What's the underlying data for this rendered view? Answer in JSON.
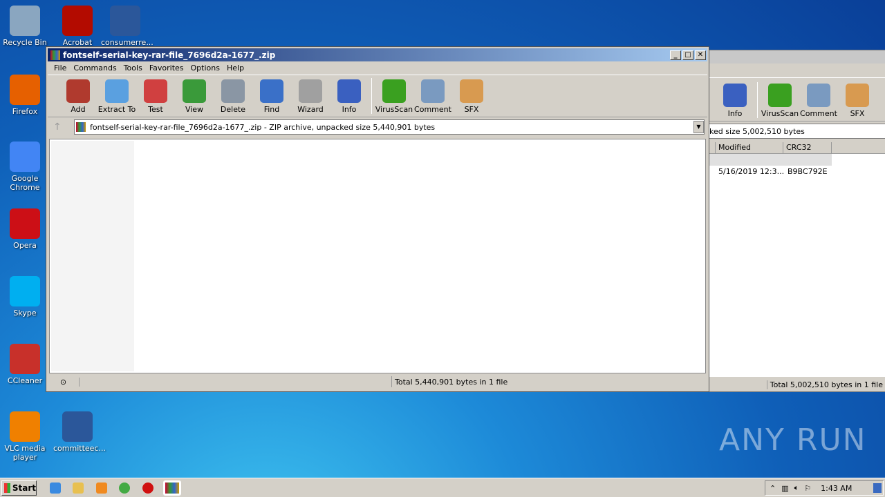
{
  "desktop": {
    "icons": [
      {
        "label": "Recycle Bin",
        "color": "#8aa6c0"
      },
      {
        "label": "Acrobat",
        "color": "#b30b00"
      },
      {
        "label": "consumerre...",
        "color": "#2b579a"
      },
      {
        "label": "Firefox",
        "color": "#e66000"
      },
      {
        "label": "Google Chrome",
        "color": "#4285f4"
      },
      {
        "label": "Opera",
        "color": "#cc0f16"
      },
      {
        "label": "Skype",
        "color": "#00aff0"
      },
      {
        "label": "CCleaner",
        "color": "#c8302a"
      },
      {
        "label": "VLC media player",
        "color": "#f08000"
      },
      {
        "label": "committeec...",
        "color": "#2b579a"
      }
    ]
  },
  "front": {
    "title": "fontself-serial-key-rar-file_7696d2a-1677_.zip",
    "menu": [
      "File",
      "Commands",
      "Tools",
      "Favorites",
      "Options",
      "Help"
    ],
    "toolbar": [
      {
        "label": "Add",
        "color": "#b03a2e"
      },
      {
        "label": "Extract To",
        "color": "#5aa0e0"
      },
      {
        "label": "Test",
        "color": "#d04040"
      },
      {
        "label": "View",
        "color": "#3a9a3a"
      },
      {
        "label": "Delete",
        "color": "#8a96a4"
      },
      {
        "label": "Find",
        "color": "#3a70c8"
      },
      {
        "label": "Wizard",
        "color": "#a0a0a0"
      },
      {
        "label": "Info",
        "color": "#3a60c0"
      }
    ],
    "toolbar2": [
      {
        "label": "VirusScan",
        "color": "#3aa020"
      },
      {
        "label": "Comment",
        "color": "#7a9ac0"
      },
      {
        "label": "SFX",
        "color": "#d89a50"
      }
    ],
    "address": "fontself-serial-key-rar-file_7696d2a-1677_.zip - ZIP archive, unpacked size 5,440,901 bytes",
    "status": "Total 5,440,901 bytes in 1 file"
  },
  "back": {
    "toolbar": [
      "Info",
      "VirusScan",
      "Comment",
      "SFX"
    ],
    "address": "ked size 5,002,510 bytes",
    "columns": [
      "Modified",
      "CRC32"
    ],
    "row": {
      "modified": "5/16/2019 12:3...",
      "crc": "B9BC792E"
    },
    "status": "Total 5,002,510 bytes in 1 file"
  },
  "taskbar": {
    "start": "Start",
    "clock": "1:43 AM"
  },
  "watermark": "ANY RUN"
}
